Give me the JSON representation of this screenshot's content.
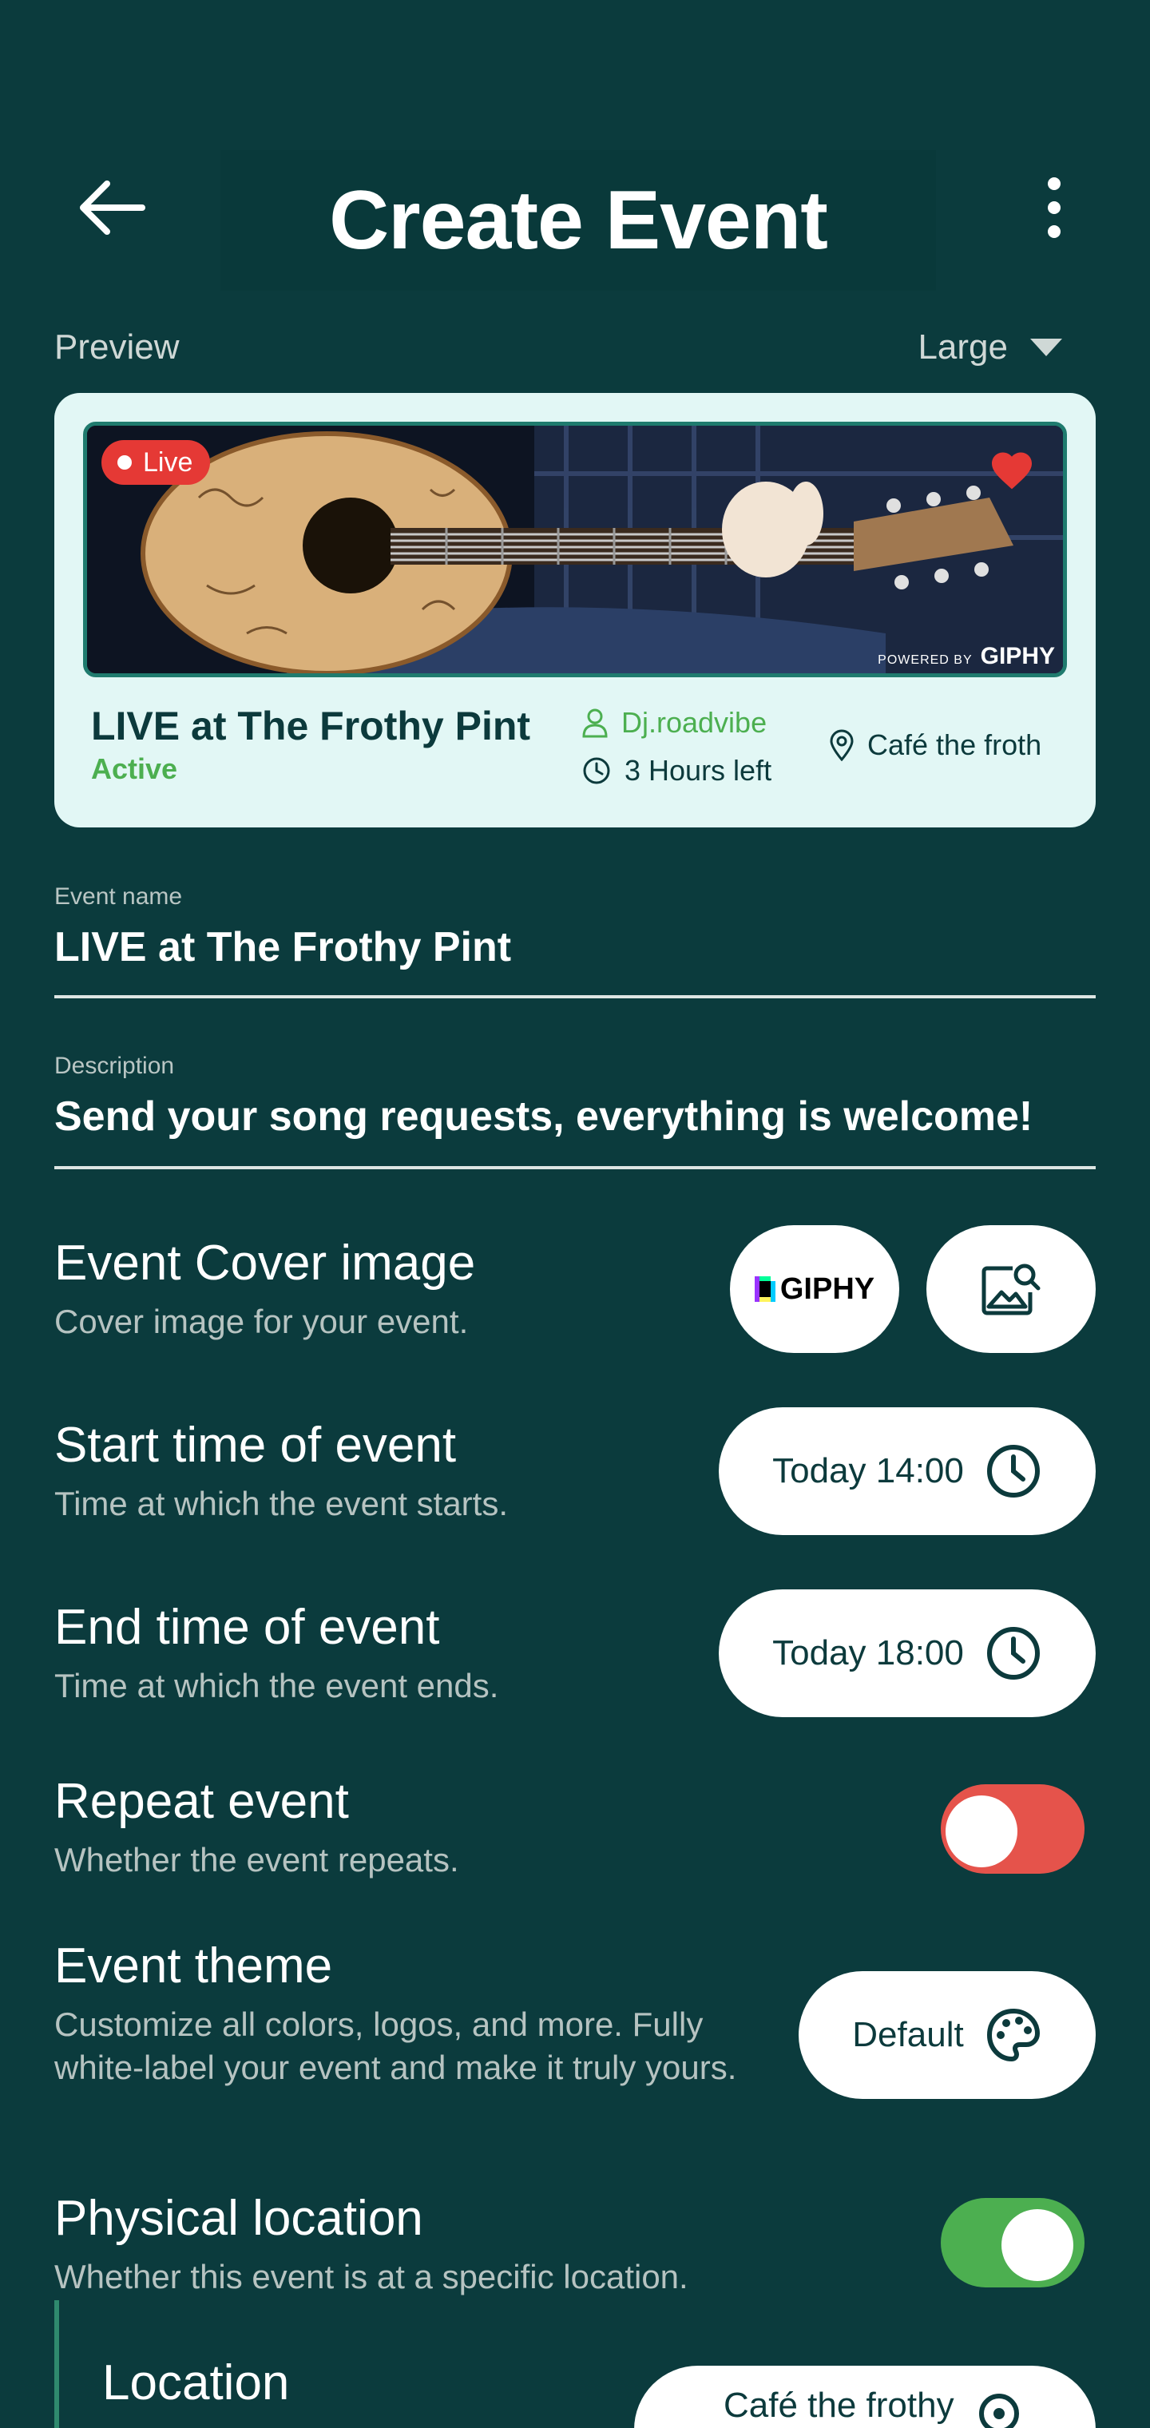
{
  "header": {
    "title": "Create Event"
  },
  "preview": {
    "label": "Preview",
    "size": "Large"
  },
  "card": {
    "live_label": "Live",
    "giphy_powered": "POWERED BY",
    "giphy_brand": "GIPHY",
    "title": "LIVE at The Frothy Pint",
    "status": "Active",
    "host": "Dj.roadvibe",
    "time_left": "3 Hours left",
    "location": "Café the froth"
  },
  "fields": {
    "name_label": "Event name",
    "name_value": "LIVE at The Frothy Pint",
    "description_label": "Description",
    "description_value": "Send your song requests, everything is welcome!"
  },
  "cover": {
    "title": "Event Cover image",
    "subtitle": "Cover image for your event.",
    "giphy_label": "GIPHY"
  },
  "start": {
    "title": "Start time of event",
    "subtitle": "Time at which the event starts.",
    "value": "Today 14:00"
  },
  "end": {
    "title": "End time of event",
    "subtitle": "Time at which the event ends.",
    "value": "Today 18:00"
  },
  "repeat": {
    "title": "Repeat event",
    "subtitle": "Whether the event repeats.",
    "enabled": false
  },
  "theme": {
    "title": "Event theme",
    "subtitle": "Customize all colors, logos, and more. Fully white-label your event and make it truly yours.",
    "value": "Default"
  },
  "physical": {
    "title": "Physical location",
    "subtitle": "Whether this event is at a specific location.",
    "enabled": true
  },
  "location": {
    "title": "Location",
    "value": "Café the frothy"
  },
  "colors": {
    "background": "#0b3b3d",
    "accent_green": "#4caf50",
    "live_red": "#e53935",
    "toggle_off": "#e5534b",
    "card_bg": "#e2f7f5"
  }
}
